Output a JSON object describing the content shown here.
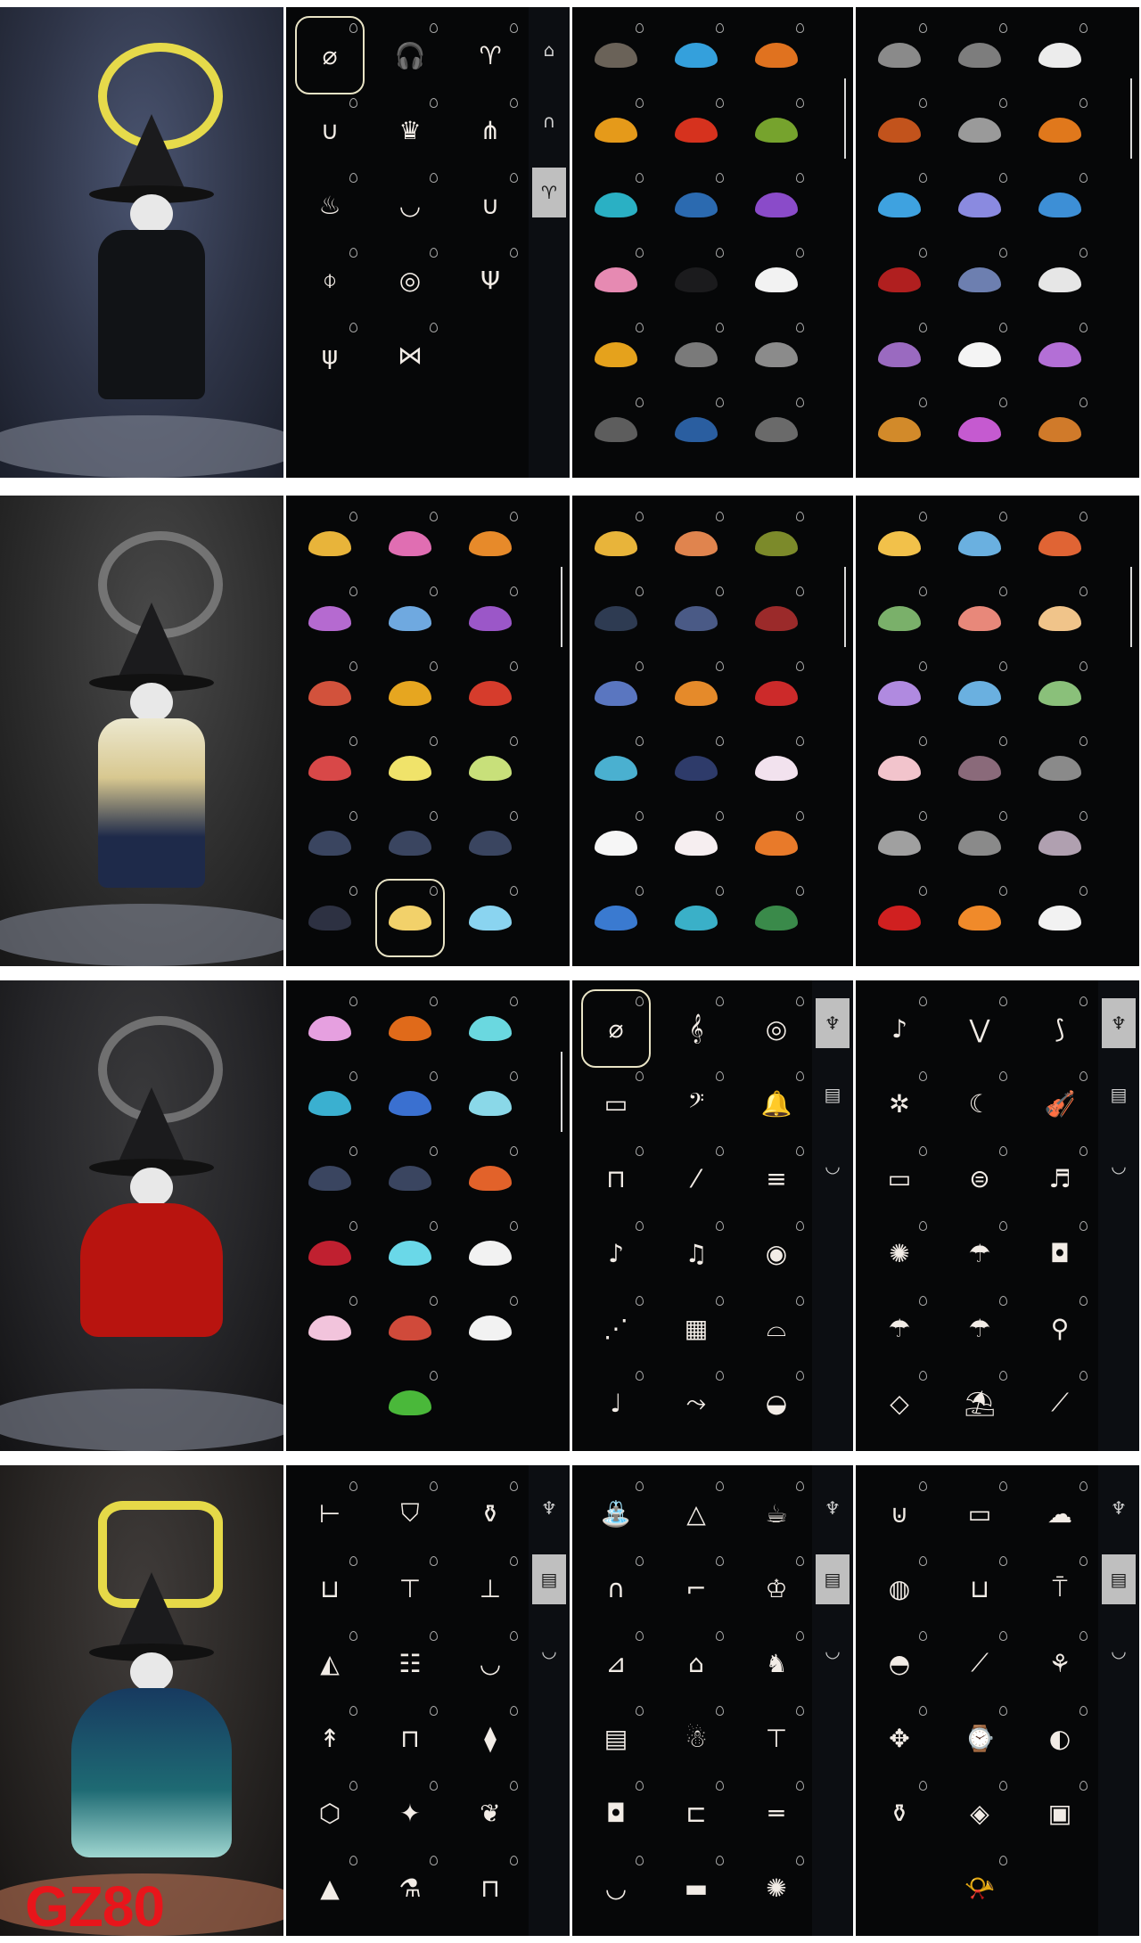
{
  "watermark": "GZ80",
  "colors": {
    "panel_bg": "#060708",
    "tab_active": "#bfbfbf",
    "halo_yellow": "#efe34a",
    "cape_red": "#b8140f",
    "cape_teal": "#1e6a73"
  },
  "rows": [
    {
      "character": {
        "cape_color": "#111316",
        "halo_color": "#efe34a"
      },
      "panels": [
        {
          "tabs": [
            "hat-icon",
            "hairpin-icon",
            "horns-icon"
          ],
          "active_tab": 2,
          "items": [
            "none",
            "headphones",
            "horns",
            "earring",
            "crown",
            "ribbons",
            "flame-horns",
            "necklace",
            "hook",
            "pendant",
            "earmuffs",
            "antlers",
            "antlers-small",
            "ribbon-bow"
          ],
          "selected": 0
        },
        {
          "items": [
            "#6a6258",
            "#34a0dc",
            "#e0721f",
            "#e59a1a",
            "#d6321e",
            "#76a32d",
            "#2ab0c4",
            "#2b6ab0",
            "#8a4bc9",
            "#e68ab2",
            "#1b1b1d",
            "#f2f2f2",
            "#e5a21c",
            "#7a7a7a",
            "#8b8b8b",
            "#5d5d5d",
            "#2a5ea0",
            "#6a6a6a"
          ]
        },
        {
          "items": [
            "#8a8a8a",
            "#7d7d7d",
            "#ececec",
            "#c2531c",
            "#9a9a9a",
            "#e0781c",
            "#3ea2e0",
            "#8a8ae0",
            "#3d8fd6",
            "#b01f1f",
            "#6d7fb0",
            "#e6e6e6",
            "#9a6ac0",
            "#f4f4f4",
            "#b36fd6",
            "#d28a2a",
            "#c55ad0",
            "#d07a2a"
          ]
        }
      ]
    },
    {
      "character": {
        "cape_color": "#ece8cf",
        "halo_color": "#efe34a"
      },
      "panels": [
        {
          "items": [
            "#e8b43a",
            "#e06eb2",
            "#e78a2a",
            "#b56ad0",
            "#6fa9e0",
            "#9b57c8",
            "#d2523c",
            "#e6a620",
            "#d63c2c",
            "#d84848",
            "#f0e36a",
            "#c8e07a",
            "#3a4560",
            "#3a4560",
            "#3a4560",
            "#2d3142",
            "#f2d16a",
            "#8ad4f0"
          ],
          "selected": 16
        },
        {
          "items": [
            "#e8b43a",
            "#e0844e",
            "#7c8a2a",
            "#2e3b52",
            "#4a5a86",
            "#9b2a2a",
            "#5a76c0",
            "#e58a2a",
            "#cc2a2a",
            "#4ab0d0",
            "#2e3b6a",
            "#f2e2ee",
            "#f6f6f6",
            "#f6eef0",
            "#e87a2a",
            "#3a7ad0",
            "#3ab0c8",
            "#3a8a4a"
          ]
        },
        {
          "items": [
            "#f2c14a",
            "#6ab0e0",
            "#e06434",
            "#7ab06a",
            "#e8887a",
            "#f0c48a",
            "#b08ae0",
            "#6ab0e0",
            "#8ac07a",
            "#f2c4cc",
            "#8a6a7a",
            "#8a8a8a",
            "#a0a0a0",
            "#8a8a8a",
            "#b0a0b0",
            "#d02020",
            "#f08a2a",
            "#f2f2f2"
          ]
        }
      ]
    },
    {
      "character": {
        "cape_color": "#b8140f",
        "halo_color": "#efe34a"
      },
      "panels": [
        {
          "items": [
            "#e6a0e0",
            "#e06a1a",
            "#6ad8e0",
            "#3ab0d0",
            "#3a70d0",
            "#8ad8e8",
            "#3a4560",
            "#3a4560",
            "#e2622a",
            "#c02030",
            "#6ad8e8",
            "#f2f2f2",
            "#f2c4dc",
            "#d04a3a",
            "#f2f2f2",
            "",
            "#4ab83a",
            ""
          ]
        },
        {
          "tabs": [
            "lyre-icon",
            "furniture-icon",
            "cup-icon"
          ],
          "active_tab": 0,
          "items": [
            "none",
            "harp",
            "mandolin-round",
            "keyboard",
            "horn",
            "bell",
            "lantern-stand",
            "flute",
            "pan-flute",
            "ukulele",
            "guitar",
            "banjo",
            "xylophone",
            "piano",
            "djembe",
            "pipa",
            "trumpet",
            "bell-bowl"
          ],
          "selected": 0
        },
        {
          "tabs": [
            "lyre-icon",
            "furniture-icon",
            "cup-icon"
          ],
          "active_tab": 0,
          "items": [
            "electric-guitar",
            "flying-v",
            "electric-wing",
            "spin-wheel",
            "moon-drum",
            "violin",
            "harmonica",
            "drum",
            "saxophone",
            "fireworks",
            "parasol",
            "lantern-box",
            "umbrella",
            "spiral-umbrella",
            "staff",
            "hanging-lantern",
            "beach-umbrella",
            "surfboard"
          ]
        }
      ]
    },
    {
      "character": {
        "cape_color": "#1e6a73",
        "halo_color": "#efe34a"
      },
      "panels": [
        {
          "tabs": [
            "lyre-icon",
            "furniture-icon",
            "cup-icon"
          ],
          "active_tab": 1,
          "items": [
            "chair",
            "banner",
            "flask",
            "bucket",
            "stool",
            "table-round",
            "bag",
            "shelf",
            "hammock",
            "torch",
            "desk",
            "pine-lamp",
            "mirror",
            "sparkle-lamp",
            "bonsai",
            "tent",
            "teapot",
            "swing"
          ]
        },
        {
          "tabs": [
            "lyre-icon",
            "furniture-icon",
            "cup-icon"
          ],
          "active_tab": 1,
          "items": [
            "fountain",
            "tent-small",
            "teapot-large",
            "arch",
            "lounger",
            "throne",
            "deck-chair",
            "doghouse",
            "rocking-horse",
            "cabinet",
            "snowman",
            "stool-pink",
            "cushion",
            "armchair",
            "bench",
            "bowl",
            "bed",
            "crab-stool"
          ]
        },
        {
          "tabs": [
            "lyre-icon",
            "furniture-icon",
            "cup-icon"
          ],
          "active_tab": 1,
          "items": [
            "basket",
            "bed-pink",
            "sheep",
            "cake",
            "bath",
            "floor-lamp",
            "cat-bed",
            "branch",
            "plant-hang",
            "chandelier",
            "grandfather-clock",
            "bread",
            "pot",
            "box-lamp",
            "crate",
            "",
            "gramophone",
            ""
          ]
        }
      ]
    }
  ]
}
